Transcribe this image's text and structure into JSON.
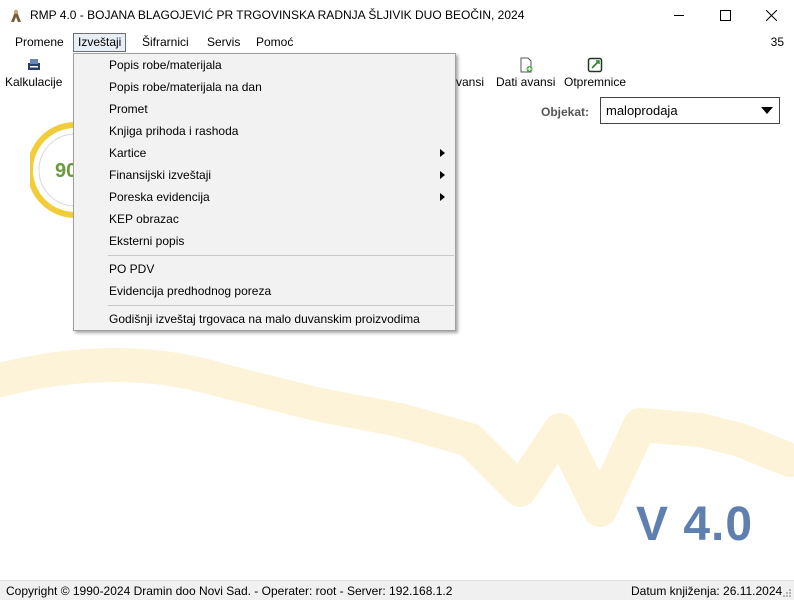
{
  "window": {
    "title": "RMP 4.0 - BOJANA BLAGOJEVIĆ PR TRGOVINSKA RADNJA ŠLJIVIK DUO BEOČIN, 2024"
  },
  "menubar": {
    "items": [
      "Promene",
      "Izveštaji",
      "Šifrarnici",
      "Servis",
      "Pomoć"
    ],
    "active": "Izveštaji",
    "right_number": "35"
  },
  "toolbar": {
    "kalkulacije": "Kalkulacije",
    "avansi_partial": "vansi",
    "dati_avansi": "Dati avansi",
    "otpremnice": "Otpremnice"
  },
  "objekat": {
    "label": "Objekat:",
    "value": "maloprodaja"
  },
  "dropdown": {
    "items": [
      {
        "label": "Popis robe/materijala",
        "submenu": false
      },
      {
        "label": "Popis robe/materijala na dan",
        "submenu": false
      },
      {
        "label": "Promet",
        "submenu": false
      },
      {
        "label": "Knjiga prihoda i rashoda",
        "submenu": false
      },
      {
        "label": "Kartice",
        "submenu": true
      },
      {
        "label": "Finansijski izveštaji",
        "submenu": true
      },
      {
        "label": "Poreska evidencija",
        "submenu": true
      },
      {
        "label": "KEP obrazac",
        "submenu": false
      },
      {
        "label": "Eksterni popis",
        "submenu": false
      },
      {
        "label": "PO PDV",
        "submenu": false
      },
      {
        "label": "Evidencija predhodnog poreza",
        "submenu": false
      },
      {
        "label": "Godišnji izveštaj trgovaca na malo duvanskim proizvodima",
        "submenu": false
      }
    ]
  },
  "background": {
    "logo_text": "90",
    "version": "V 4.0"
  },
  "statusbar": {
    "left": "Copyright © 1990-2024 Dramin doo Novi Sad. - Operater: root - Server: 192.168.1.2",
    "right": "Datum knjiženja: 26.11.2024"
  },
  "colors": {
    "accent": "#5e7fb0",
    "wave": "#fdf3d8",
    "logo_ring": "#f2cd3a"
  }
}
